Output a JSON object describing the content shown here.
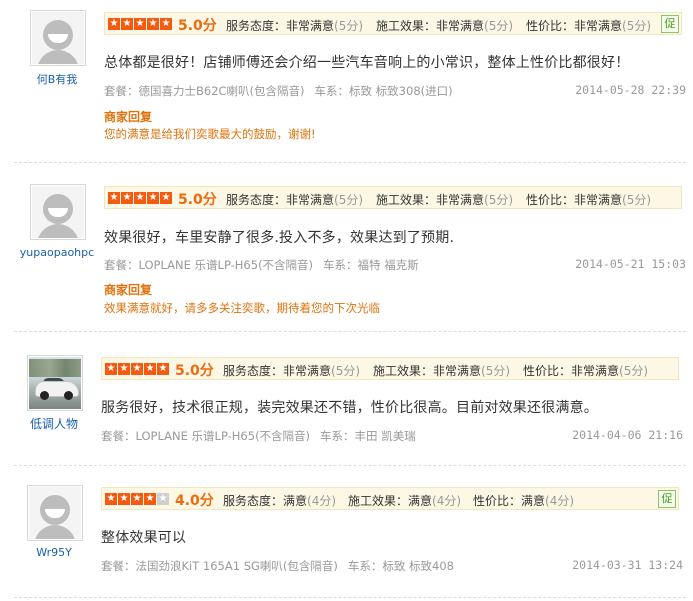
{
  "labels": {
    "service": "服务态度：",
    "construction": "施工效果：",
    "value": "性价比：",
    "package": "套餐：",
    "car_series": "车系：",
    "merchant_reply": "商家回复",
    "verified_icon": "促"
  },
  "reviews": [
    {
      "username": "何B有我",
      "avatar": "placeholder-avatar",
      "stars": 5,
      "score": "5.0分",
      "service": {
        "value": "非常满意",
        "points": "(5分)"
      },
      "construction": {
        "value": "非常满意",
        "points": "(5分)"
      },
      "value_for_money": {
        "value": "非常满意",
        "points": "(5分)"
      },
      "verified": true,
      "content": "总体都是很好！店铺师傅还会介绍一些汽车音响上的小常识，整体上性价比都很好！",
      "package": "德国喜力士B62C喇叭(包含隔音)",
      "car_series": "标致  标致308(进口)",
      "date": "2014-05-28 22:39",
      "reply": "您的满意是给我们奕歌最大的鼓励，谢谢!"
    },
    {
      "username": "yupaopaohpc",
      "avatar": "placeholder-avatar",
      "stars": 5,
      "score": "5.0分",
      "service": {
        "value": "非常满意",
        "points": "(5分)"
      },
      "construction": {
        "value": "非常满意",
        "points": "(5分)"
      },
      "value_for_money": {
        "value": "非常满意",
        "points": "(5分)"
      },
      "verified": false,
      "content": "效果很好，车里安静了很多.投入不多，效果达到了预期.",
      "package": "LOPLANE 乐谱LP-H65(不含隔音)",
      "car_series": "福特  福克斯",
      "date": "2014-05-21 15:03",
      "reply": "效果满意就好，请多多关注奕歌，期待着您的下次光临"
    },
    {
      "username": "低调人物",
      "avatar": "car-photo-avatar",
      "stars": 5,
      "score": "5.0分",
      "service": {
        "value": "非常满意",
        "points": "(5分)"
      },
      "construction": {
        "value": "非常满意",
        "points": "(5分)"
      },
      "value_for_money": {
        "value": "非常满意",
        "points": "(5分)"
      },
      "verified": false,
      "content": "服务很好，技术很正规，装完效果还不错，性价比很高。目前对效果还很满意。",
      "package": "LOPLANE 乐谱LP-H65(不含隔音)",
      "car_series": "丰田  凯美瑞",
      "date": "2014-04-06 21:16",
      "reply": null
    },
    {
      "username": "Wr95Y",
      "avatar": "placeholder-avatar",
      "stars": 4,
      "score": "4.0分",
      "service": {
        "value": "满意",
        "points": "(4分)"
      },
      "construction": {
        "value": "满意",
        "points": "(4分)"
      },
      "value_for_money": {
        "value": "满意",
        "points": "(4分)"
      },
      "verified": true,
      "content": "整体效果可以",
      "package": "法国劲浪KiT 165A1 SG喇叭(包含隔音)",
      "car_series": "标致  标致408",
      "date": "2014-03-31 13:24",
      "reply": null
    }
  ],
  "colors": {
    "accent": "#ee6a0f",
    "star_on": "#f55a11",
    "star_off": "#cfcfcf",
    "link": "#1a5fae",
    "muted": "#999999",
    "rating_bar_bg": "#fdf8e6"
  }
}
